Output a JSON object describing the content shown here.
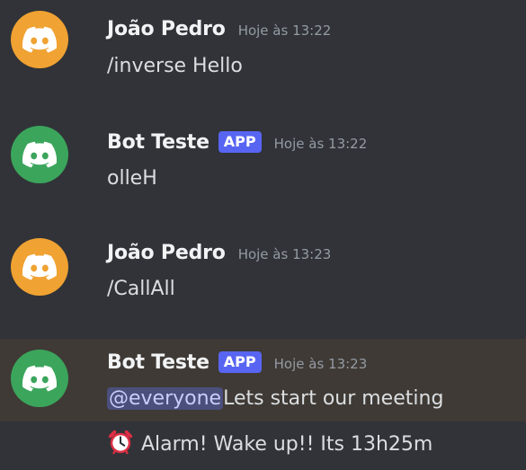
{
  "colors": {
    "background": "#313338",
    "highlight_background": "#3f3a35",
    "avatar_user": "#f0a232",
    "avatar_bot": "#3ba55c",
    "app_tag": "#5865f2",
    "mention_bg": "#4a4f7c"
  },
  "messages": [
    {
      "username": "João Pedro",
      "timestamp": "Hoje às 13:22",
      "content": "/inverse Hello",
      "avatar_icon": "discord-logo-icon"
    },
    {
      "username": "Bot Teste",
      "tag": "APP",
      "timestamp": "Hoje às 13:22",
      "content": "olleH",
      "avatar_icon": "discord-logo-icon"
    },
    {
      "username": "João Pedro",
      "timestamp": "Hoje às 13:23",
      "content": "/CallAll",
      "avatar_icon": "discord-logo-icon"
    },
    {
      "username": "Bot Teste",
      "tag": "APP",
      "timestamp": "Hoje às 13:23",
      "mention": "@everyone",
      "content": "Lets start our meeting",
      "avatar_icon": "discord-logo-icon"
    }
  ],
  "followup": {
    "icon": "alarm-clock-icon",
    "content": "Alarm! Wake up!! Its 13h25m"
  }
}
